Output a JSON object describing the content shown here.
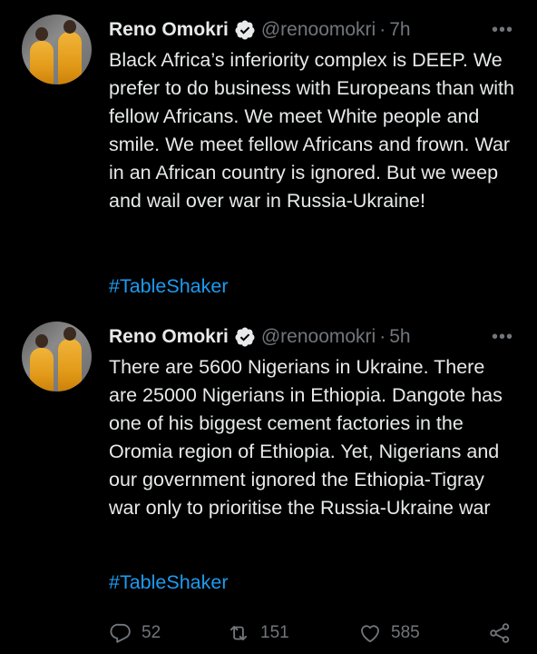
{
  "tweets": [
    {
      "name": "Reno Omokri",
      "handle": "@renoomokri",
      "separator": "·",
      "time": "7h",
      "more": "•••",
      "text": "Black Africa’s inferiority complex is DEEP. We prefer to do business with Europeans than with fellow Africans. We meet White people and smile. We meet fellow Africans and frown. War in an African country is ignored. But we weep and wail over war in Russia-Ukraine!",
      "hashtag": "#TableShaker"
    },
    {
      "name": "Reno Omokri",
      "handle": "@renoomokri",
      "separator": "·",
      "time": "5h",
      "more": "•••",
      "text": "There are 5600 Nigerians in Ukraine. There are 25000 Nigerians in Ethiopia. Dangote has one of his biggest cement factories in the Oromia region of Ethiopia. Yet, Nigerians and our government ignored the Ethiopia-Tigray war only to prioritise the Russia-Ukraine war",
      "hashtag": "#TableShaker",
      "actions": {
        "reply_count": "52",
        "retweet_count": "151",
        "like_count": "585"
      }
    }
  ],
  "icons": {
    "verified": "verified-badge-icon",
    "reply": "reply-icon",
    "retweet": "retweet-icon",
    "like": "heart-icon",
    "share": "share-icon",
    "more": "more-icon"
  },
  "colors": {
    "background": "#000000",
    "text": "#e7e9ea",
    "muted": "#71767b",
    "link": "#1d9bf0"
  }
}
